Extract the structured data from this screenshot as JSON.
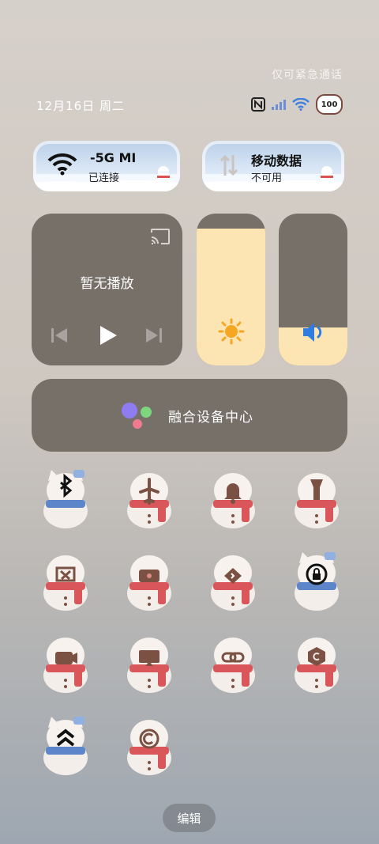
{
  "status": {
    "emergency_only": "仅可紧急通话",
    "date": "12月16日 周二",
    "battery": "100",
    "icons": [
      "nfc-icon",
      "signal-icon",
      "wifi-icon",
      "battery-icon"
    ]
  },
  "wifi_tile": {
    "title": "-5G   MI",
    "subtitle": "已连接"
  },
  "mobile_tile": {
    "title": "移动数据",
    "subtitle": "不可用"
  },
  "media": {
    "label": "暂无播放"
  },
  "brightness": {
    "level": 0.9
  },
  "volume": {
    "level": 0.25
  },
  "fusion": {
    "label": "融合设备中心"
  },
  "toggles": [
    {
      "name": "bluetooth",
      "style": "cat"
    },
    {
      "name": "airplane-mode",
      "style": "snowman"
    },
    {
      "name": "ring-mode",
      "style": "snowman"
    },
    {
      "name": "flashlight",
      "style": "snowman"
    },
    {
      "name": "screenshot",
      "style": "snowman"
    },
    {
      "name": "screen-record",
      "style": "snowman"
    },
    {
      "name": "location",
      "style": "snowman"
    },
    {
      "name": "rotation-lock",
      "style": "cat"
    },
    {
      "name": "camera",
      "style": "snowman"
    },
    {
      "name": "cast",
      "style": "snowman"
    },
    {
      "name": "link",
      "style": "snowman"
    },
    {
      "name": "hexagon-c",
      "style": "snowman"
    },
    {
      "name": "chevrons-up",
      "style": "cat"
    },
    {
      "name": "circle-c",
      "style": "snowman"
    }
  ],
  "edit_label": "编辑",
  "colors": {
    "panel": "#777069",
    "slider_fill": "#fde4b3",
    "sun": "#f5a623",
    "speaker": "#2f7de1",
    "tile_icon": "#7a5142"
  }
}
